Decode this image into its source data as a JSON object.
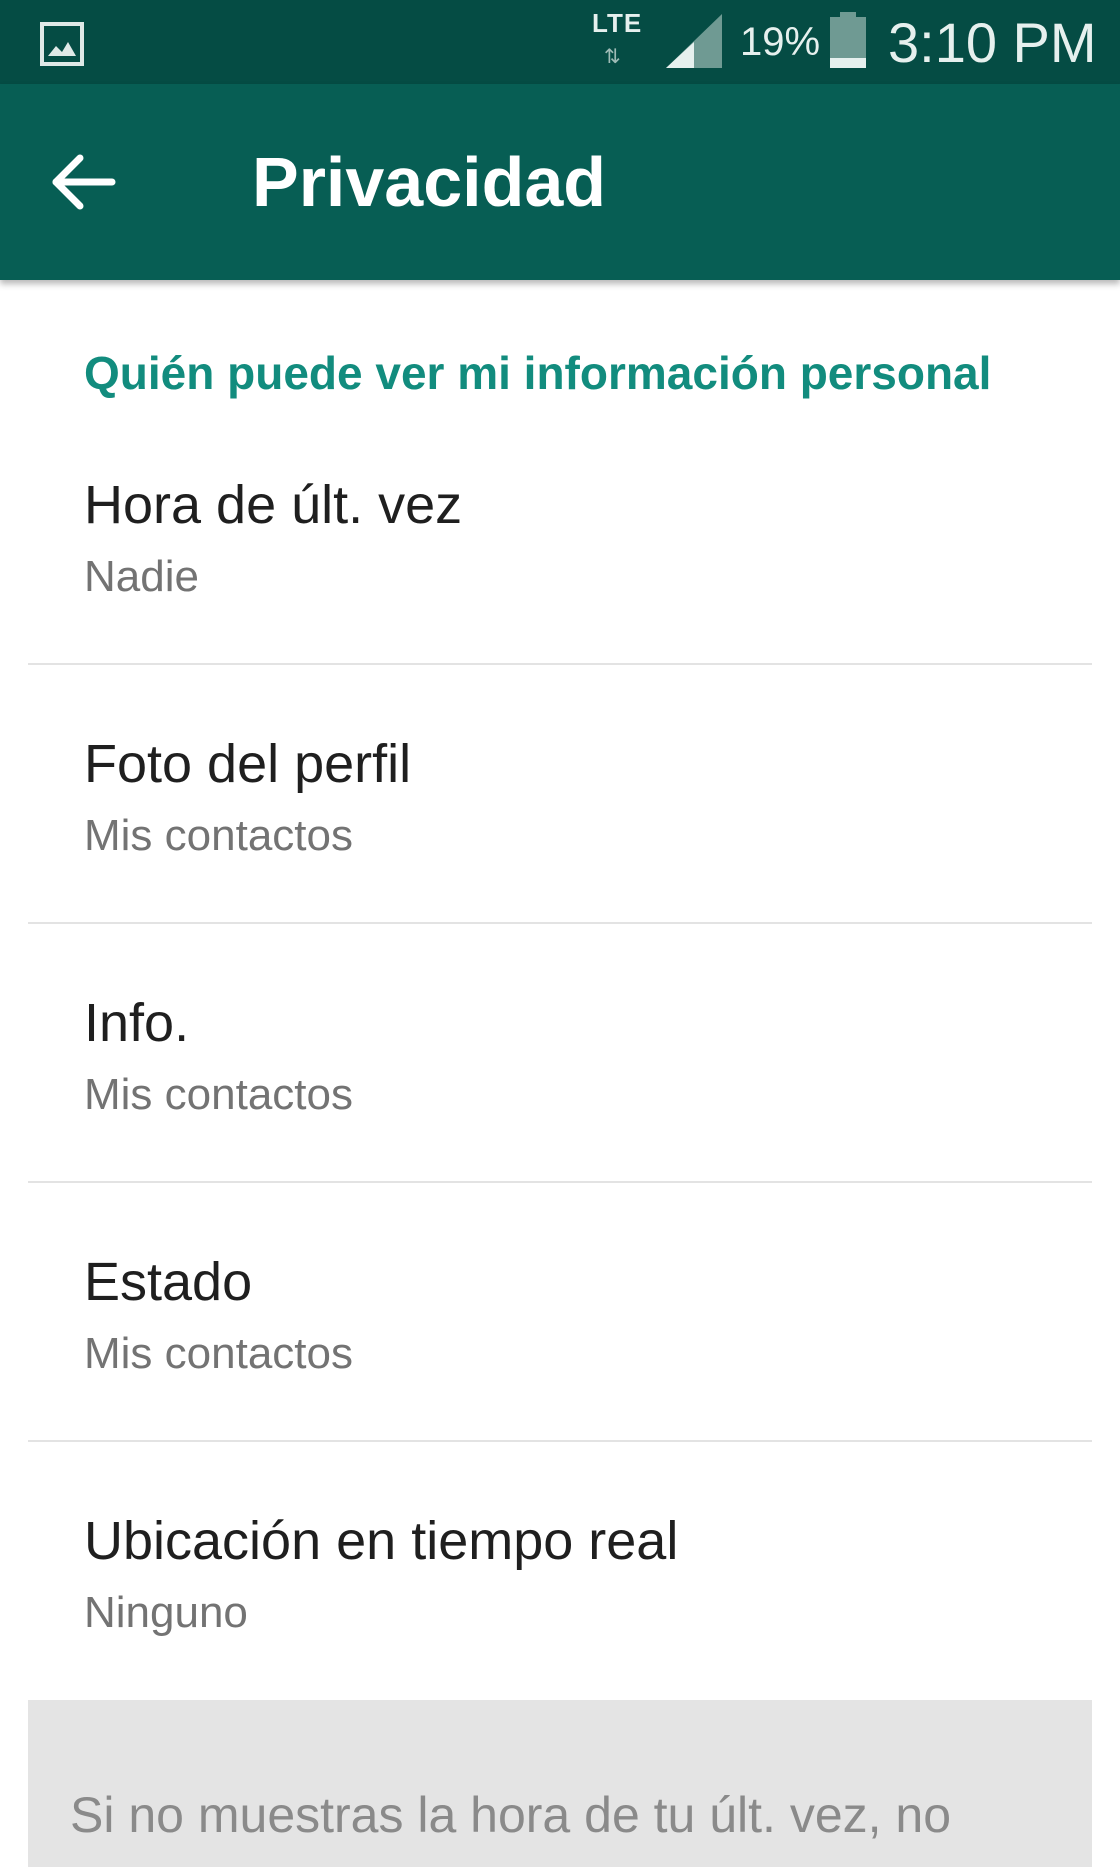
{
  "status_bar": {
    "network": "LTE",
    "network_arrows": "⇅",
    "battery_percent": "19%",
    "time": "3:10 PM",
    "icons": [
      "gallery-notification-icon",
      "signal-icon",
      "battery-icon"
    ]
  },
  "app_bar": {
    "title": "Privacidad",
    "back_icon": "arrow-left-icon"
  },
  "section": {
    "header": "Quién puede ver mi información personal"
  },
  "settings": [
    {
      "title": "Hora de últ. vez",
      "value": "Nadie"
    },
    {
      "title": "Foto del perfil",
      "value": "Mis contactos"
    },
    {
      "title": "Info.",
      "value": "Mis contactos"
    },
    {
      "title": "Estado",
      "value": "Mis contactos"
    },
    {
      "title": "Ubicación en tiempo real",
      "value": "Ninguno"
    }
  ],
  "info_note": "Si no muestras la hora de tu últ. vez, no podrás ver la hora de últ. vez de los",
  "colors": {
    "status_bar": "#054c44",
    "app_bar": "#075e54",
    "accent": "#128c7e",
    "info_box": "#e4e4e4"
  }
}
